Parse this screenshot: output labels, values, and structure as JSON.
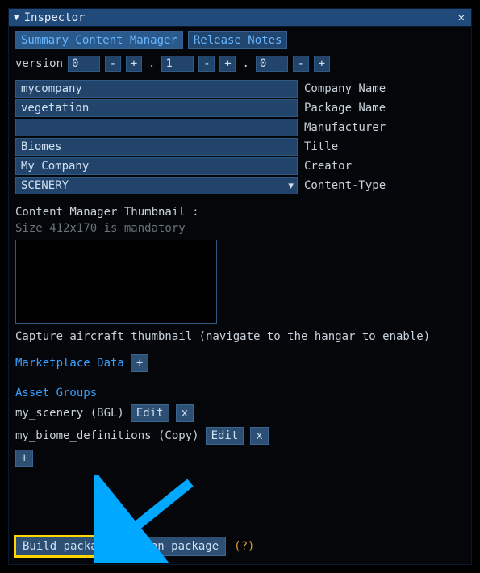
{
  "window": {
    "title": "Inspector"
  },
  "tabs": {
    "summary": "Summary Content Manager",
    "release_notes": "Release Notes"
  },
  "version": {
    "label": "version",
    "major": "0",
    "minor": "1",
    "patch": "0"
  },
  "fields": [
    {
      "value": "mycompany",
      "label": "Company Name"
    },
    {
      "value": "vegetation",
      "label": "Package Name"
    },
    {
      "value": "",
      "label": "Manufacturer"
    },
    {
      "value": "Biomes",
      "label": "Title"
    },
    {
      "value": "My Company",
      "label": "Creator"
    }
  ],
  "content_type": {
    "value": "SCENERY",
    "label": "Content-Type"
  },
  "thumbnail": {
    "heading": "Content Manager Thumbnail :",
    "hint": "Size 412x170 is mandatory",
    "caption": "Capture aircraft thumbnail (navigate to the hangar to enable)"
  },
  "marketplace": {
    "heading": "Marketplace Data",
    "add": "+"
  },
  "asset_groups": {
    "heading": "Asset Groups",
    "items": [
      {
        "name": "my_scenery (BGL)"
      },
      {
        "name": "my_biome_definitions (Copy)"
      }
    ],
    "edit": "Edit",
    "remove": "x",
    "add": "+"
  },
  "footer": {
    "build": "Build package",
    "clean": "Clean package",
    "help": "(?)"
  },
  "colors": {
    "arrow": "#00a8ff",
    "highlight": "#ffd400"
  }
}
